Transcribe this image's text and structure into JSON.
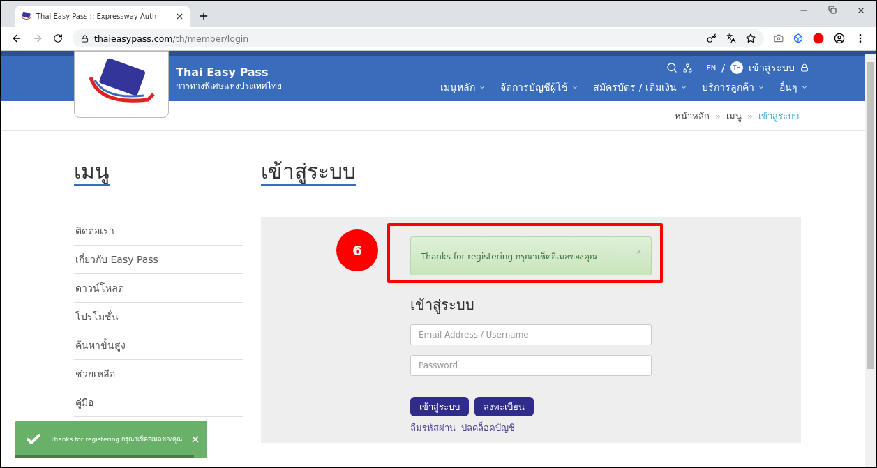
{
  "browser": {
    "tab_title": "Thai Easy Pass :: Expressway Auth",
    "url_domain": "thaieasypass.com",
    "url_path": "/th/member/login"
  },
  "header": {
    "brand": "Thai Easy Pass",
    "subtitle": "การทางพิเศษแห่งประเทศไทย",
    "lang": "EN",
    "lang_separator": "/",
    "lang_badge": "TH",
    "login": "เข้าสู่ระบบ",
    "nav": [
      {
        "label": "เมนูหลัก"
      },
      {
        "label": "จัดการบัญชีผู้ใช้"
      },
      {
        "label": "สมัครบัตร / เติมเงิน"
      },
      {
        "label": "บริการลูกค้า"
      },
      {
        "label": "อื่นๆ"
      }
    ]
  },
  "breadcrumb": {
    "separator": "»",
    "items": [
      {
        "label": "หน้าหลัก",
        "selected": false
      },
      {
        "label": "เมนู",
        "selected": false
      },
      {
        "label": "เข้าสู่ระบบ",
        "selected": true
      }
    ]
  },
  "sidebar": {
    "title": "เมนู",
    "items": [
      {
        "label": "ติดต่อเรา"
      },
      {
        "label": "เกี่ยวกับ Easy Pass"
      },
      {
        "label": "ดาวน์โหลด"
      },
      {
        "label": "โปรโมชั่น"
      },
      {
        "label": "ค้นหาขั้นสูง"
      },
      {
        "label": "ช่วยเหลือ"
      },
      {
        "label": "คู่มือ"
      }
    ]
  },
  "main": {
    "title": "เข้าสู่ระบบ",
    "alert": {
      "text": "Thanks for registering กรุณาเช็คอีเมลของคุณ",
      "close": "x"
    },
    "form_title": "เข้าสู่ระบบ",
    "fields": [
      {
        "placeholder": "Email Address / Username"
      },
      {
        "placeholder": "Password"
      }
    ],
    "buttons": [
      "เข้าสู่ระบบ",
      "ลงทะเบียน"
    ],
    "links": [
      "ลืมรหัสผ่าน",
      "ปลดล็อคบัญชี"
    ]
  },
  "annotation": {
    "step": "6"
  },
  "toast": {
    "text": "Thanks for registering กรุณาเช็คอีเมลของคุณ",
    "level": 0.93
  }
}
